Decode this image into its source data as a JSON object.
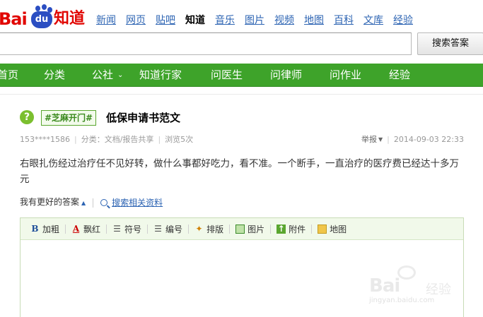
{
  "logo": {
    "bai": "Bai",
    "du": "du",
    "zhidao": "知道"
  },
  "topnav": [
    {
      "label": "新闻",
      "active": false
    },
    {
      "label": "网页",
      "active": false
    },
    {
      "label": "贴吧",
      "active": false
    },
    {
      "label": "知道",
      "active": true
    },
    {
      "label": "音乐",
      "active": false
    },
    {
      "label": "图片",
      "active": false
    },
    {
      "label": "视频",
      "active": false
    },
    {
      "label": "地图",
      "active": false
    },
    {
      "label": "百科",
      "active": false
    },
    {
      "label": "文库",
      "active": false
    },
    {
      "label": "经验",
      "active": false
    }
  ],
  "search": {
    "value": "",
    "button_label": "搜索答案"
  },
  "greenbar": [
    {
      "label": "首页"
    },
    {
      "label": "分类"
    },
    {
      "label": "公社",
      "has_dropdown": true
    },
    {
      "label": "知道行家"
    },
    {
      "label": "问医生"
    },
    {
      "label": "问律师"
    },
    {
      "label": "问作业"
    },
    {
      "label": "经验"
    }
  ],
  "question": {
    "icon_glyph": "?",
    "tag": "#芝麻开门#",
    "title": "低保申请书范文",
    "author": "153****1586",
    "category": "分类：文档/报告共享",
    "views": "浏览5次",
    "report": "举报",
    "date": "2014-09-03 22:33",
    "body": "右眼扎伤经过治疗任不见好转，做什么事都好吃力，看不准。一个断手，一直治疗的医疗费已经达十多万元"
  },
  "actions": {
    "better_answer": "我有更好的答案",
    "search_related": "搜索相关资料"
  },
  "toolbar": [
    {
      "icon": "bold-icon",
      "glyph": "B",
      "label": "加粗"
    },
    {
      "icon": "text-color-icon",
      "glyph": "A",
      "label": "飘红"
    },
    {
      "icon": "bullet-list-icon",
      "glyph": "☰",
      "label": "符号"
    },
    {
      "icon": "numbered-list-icon",
      "glyph": "☰",
      "label": "编号"
    },
    {
      "icon": "magic-wand-icon",
      "glyph": "✦",
      "label": "排版"
    },
    {
      "icon": "image-icon",
      "glyph": "",
      "label": "图片"
    },
    {
      "icon": "attachment-icon",
      "glyph": "↑",
      "label": "附件"
    },
    {
      "icon": "map-icon",
      "glyph": "",
      "label": "地图"
    }
  ],
  "watermark": {
    "brand": "Bai",
    "jingyan": "经验",
    "url": "jingyan.baidu.com"
  },
  "colors": {
    "green": "#3ea32a",
    "link": "#2d64b3",
    "logo_red": "#e10602",
    "logo_blue": "#2b4ec2"
  }
}
